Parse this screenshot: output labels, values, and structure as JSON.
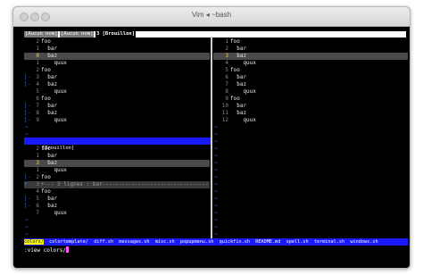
{
  "window": {
    "title": "Vim ◂ ~bash"
  },
  "tabline": {
    "tabs": [
      "[Aucun nom]",
      "[Aucun nom]",
      "3 [Brouillon]"
    ]
  },
  "top_left": [
    {
      "fold": "",
      "num": "2",
      "text": "foo",
      "cur": false
    },
    {
      "fold": "",
      "num": "1",
      "text": "  bar",
      "cur": false
    },
    {
      "fold": "",
      "num": "0",
      "text": "  baz",
      "cur": true
    },
    {
      "fold": "",
      "num": "1",
      "text": "    quux",
      "cur": false
    },
    {
      "fold": "",
      "num": "2",
      "text": "foo",
      "cur": false
    },
    {
      "fold": "|-",
      "num": "3",
      "text": "  bar",
      "cur": false
    },
    {
      "fold": "|-",
      "num": "4",
      "text": "  baz",
      "cur": false
    },
    {
      "fold": "",
      "num": "5",
      "text": "    quux",
      "cur": false
    },
    {
      "fold": "",
      "num": "6",
      "text": "foo",
      "cur": false
    },
    {
      "fold": "|-",
      "num": "7",
      "text": "  bar",
      "cur": false
    },
    {
      "fold": "|-",
      "num": "8",
      "text": "  baz",
      "cur": false
    },
    {
      "fold": "|-",
      "num": "9",
      "text": "    quux",
      "cur": false
    }
  ],
  "top_left_status": "[Brouillon]",
  "bottom_left": [
    {
      "fold": "",
      "num": "2",
      "text": "foo",
      "cur": false
    },
    {
      "fold": "",
      "num": "1",
      "text": "  bar",
      "cur": false
    },
    {
      "fold": "",
      "num": "3",
      "text": "  baz",
      "cur": true
    },
    {
      "fold": "",
      "num": "1",
      "text": "    quux",
      "cur": false
    },
    {
      "fold": "|-",
      "num": "2",
      "text": "foo",
      "cur": false
    },
    {
      "fold": "+",
      "num": "3",
      "text": "+--- 3 lignes : bar-----------------------------------------",
      "cur": false,
      "folded": true
    },
    {
      "fold": "",
      "num": "4",
      "text": "foo",
      "cur": false
    },
    {
      "fold": "|-",
      "num": "5",
      "text": "  bar",
      "cur": false
    },
    {
      "fold": "|-",
      "num": "6",
      "text": "  baz",
      "cur": false
    },
    {
      "fold": "",
      "num": "7",
      "text": "    quux",
      "cur": false
    }
  ],
  "right": [
    {
      "fold": "",
      "num": "1",
      "text": "foo",
      "cur": false
    },
    {
      "fold": "",
      "num": "2",
      "text": "  bar",
      "cur": false
    },
    {
      "fold": "",
      "num": "3",
      "text": "  baz",
      "cur": true
    },
    {
      "fold": "",
      "num": "4",
      "text": "    quux",
      "cur": false
    },
    {
      "fold": "",
      "num": "5",
      "text": "foo",
      "cur": false
    },
    {
      "fold": "",
      "num": "6",
      "text": "  bar",
      "cur": false
    },
    {
      "fold": "",
      "num": "7",
      "text": "  baz",
      "cur": false
    },
    {
      "fold": "",
      "num": "8",
      "text": "    quux",
      "cur": false
    },
    {
      "fold": "",
      "num": "9",
      "text": "foo",
      "cur": false
    },
    {
      "fold": "",
      "num": "10",
      "text": "  bar",
      "cur": false
    },
    {
      "fold": "",
      "num": "11",
      "text": "  baz",
      "cur": false
    },
    {
      "fold": "",
      "num": "12",
      "text": "    quux",
      "cur": false
    }
  ],
  "wildmenu": {
    "selected": "colors/",
    "items": "  colortemplate/  diff.sh  messages.sh  misc.sh  popupmenu.sh  quickfix.sh  README.md  spell.sh  terminal.sh  windows.sh"
  },
  "cmdline": ":view colors/",
  "colors": {
    "tilde": "#3e7cff",
    "status_active": "#1a1aff",
    "cursor_line_nr": "#ffd24a"
  }
}
